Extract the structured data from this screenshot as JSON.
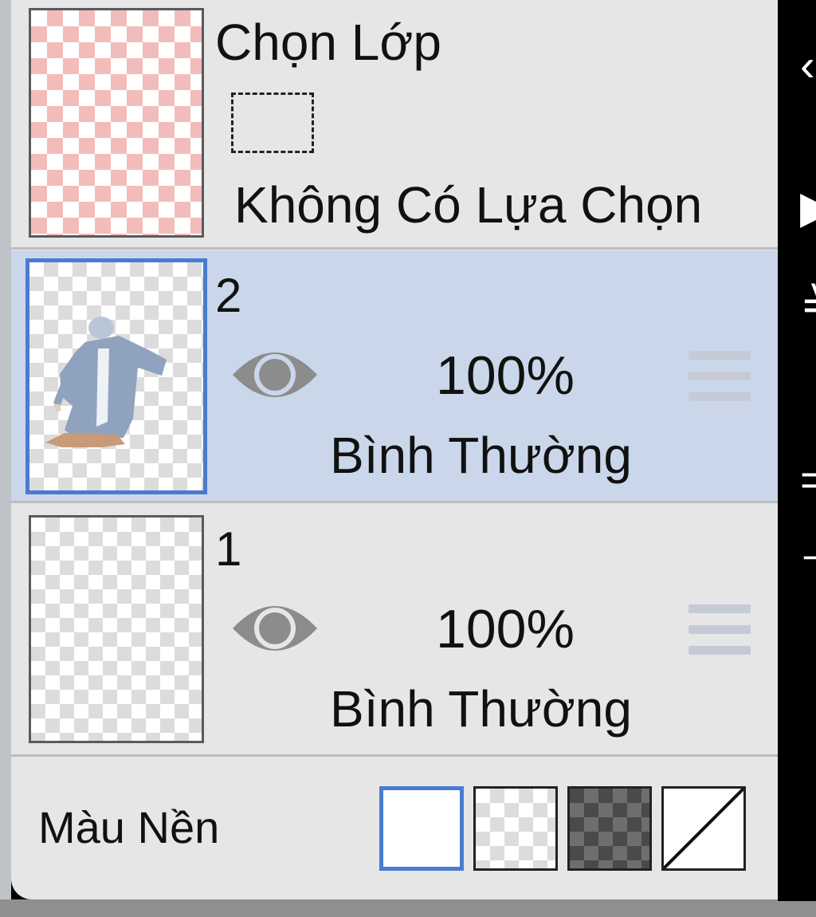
{
  "selection_layer": {
    "title": "Chọn Lớp",
    "status": "Không Có Lựa Chọn"
  },
  "layers": [
    {
      "number": "2",
      "opacity": "100%",
      "blend_mode": "Bình Thường",
      "visible": true,
      "active": true
    },
    {
      "number": "1",
      "opacity": "100%",
      "blend_mode": "Bình Thường",
      "visible": true,
      "active": false
    }
  ],
  "background": {
    "label": "Màu Nền",
    "options": [
      "white-swatch",
      "transparent-checker-swatch",
      "dark-checker-swatch",
      "none-swatch"
    ],
    "selected": "white-swatch"
  },
  "colors": {
    "accent": "#4a7bd0",
    "active_row": "#cad7ea",
    "panel": "#e6e6e6"
  }
}
